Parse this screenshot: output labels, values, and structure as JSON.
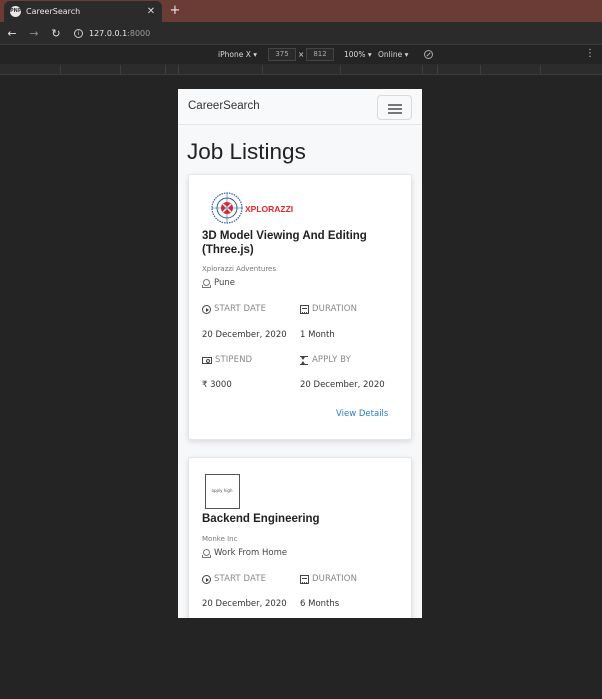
{
  "browser": {
    "tab_title": "CareerSearch",
    "favicon_text": "PNP",
    "new_tab": "+",
    "close": "✕",
    "url_host": "127.0.0.1",
    "url_port": ":8000"
  },
  "devtools": {
    "device": "iPhone X ▾",
    "width": "375",
    "times": "×",
    "height": "812",
    "zoom": "100% ▾",
    "network": "Online ▾"
  },
  "navbar": {
    "brand": "CareerSearch"
  },
  "page": {
    "title": "Job Listings"
  },
  "labels": {
    "start_date": "START DATE",
    "duration": "DURATION",
    "stipend": "STIPEND",
    "apply_by": "APPLY BY",
    "view_details": "View Details"
  },
  "jobs": [
    {
      "logo_text": "XPLORAZZI",
      "title": "3D Model Viewing And Editing (Three.js)",
      "company": "Xplorazzi Adventures",
      "location": "Pune",
      "start_date": "20 December, 2020",
      "duration": "1 Month",
      "stipend": "₹ 3000",
      "apply_by": "20 December, 2020"
    },
    {
      "logo_text": "apply high",
      "title": "Backend Engineering",
      "company": "Monke Inc",
      "location": "Work From Home",
      "start_date": "20 December, 2020",
      "duration": "6 Months"
    }
  ],
  "colors": {
    "link": "#2b7bd0",
    "tabbar": "#6b3b35",
    "logo_red": "#e3262b",
    "logo_blue": "#2a5aa8"
  }
}
